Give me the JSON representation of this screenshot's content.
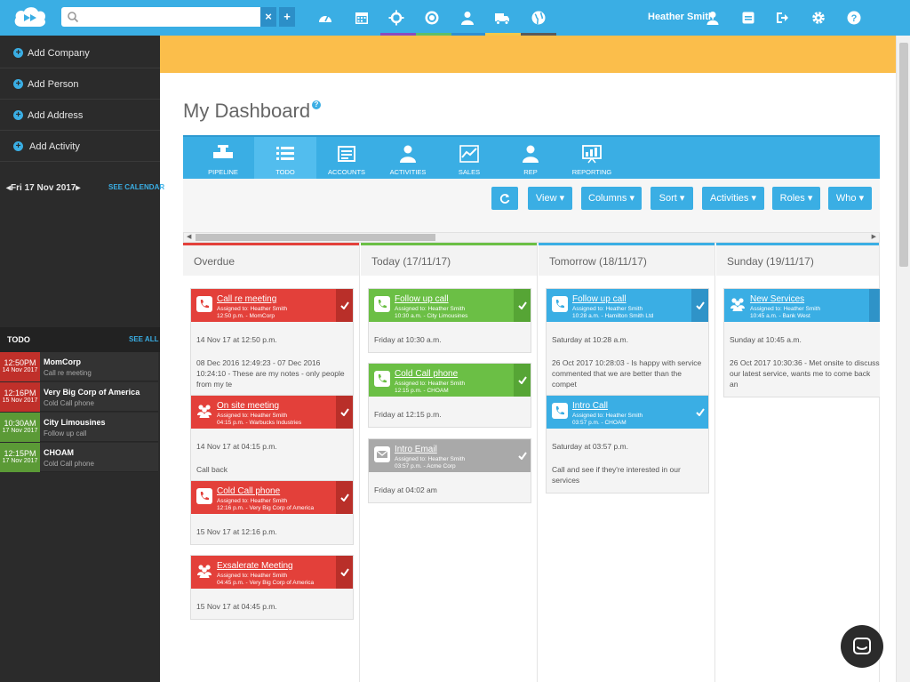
{
  "header": {
    "user_name": "Heather Smith",
    "search": {
      "value": "",
      "placeholder": ""
    },
    "clear_label": "×",
    "add_label": "+",
    "nav_icons": [
      "dashboard-icon",
      "calendar-icon",
      "pipeline-icon",
      "target-icon",
      "people-icon",
      "truck-icon",
      "globe-icon"
    ],
    "user_icons": [
      "user-icon",
      "inbox-icon",
      "logout-icon",
      "gear-icon",
      "help-icon"
    ]
  },
  "sidebar": {
    "actions": [
      "Add Company",
      "Add Person",
      "Add Address",
      "Add Activity"
    ],
    "calendar": {
      "date": "Fri 17 Nov 2017",
      "link": "SEE CALENDAR"
    },
    "todo": {
      "title": "TODO",
      "see_all": "SEE ALL",
      "items": [
        {
          "time": "12:50PM",
          "date": "14 Nov 2017",
          "title": "MomCorp",
          "subtitle": "Call re meeting",
          "color": "#c0302a"
        },
        {
          "time": "12:16PM",
          "date": "15 Nov 2017",
          "title": "Very Big Corp of America",
          "subtitle": "Cold Call phone",
          "color": "#c0302a"
        },
        {
          "time": "10:30AM",
          "date": "17 Nov 2017",
          "title": "City Limousines",
          "subtitle": "Follow up call",
          "color": "#5b9a36"
        },
        {
          "time": "12:15PM",
          "date": "17 Nov 2017",
          "title": "CHOAM",
          "subtitle": "Cold Call phone",
          "color": "#5b9a36"
        }
      ]
    }
  },
  "main": {
    "title": "My Dashboard",
    "help": "?",
    "tabs": [
      "PIPELINE",
      "TODO",
      "ACCOUNTS",
      "ACTIVITIES",
      "SALES",
      "REP",
      "REPORTING"
    ],
    "toolbar": {
      "refresh_icon": "refresh-icon",
      "buttons": [
        "View ▾",
        "Columns ▾",
        "Sort ▾",
        "Activities ▾",
        "Roles ▾",
        "Who ▾"
      ]
    },
    "columns": [
      {
        "title": "Overdue",
        "color": "#e3403a",
        "cards": [
          {
            "title": "Call re meeting",
            "assigned": "Assigned to: Heather Smith",
            "meta": "12:50 p.m. - MomCorp",
            "icon": "phone-icon",
            "when": "14 Nov 17 at 12:50 p.m.",
            "note": "08 Dec 2016 12:49:23 - 07 Dec 2016 10:24:10 - These are my notes - only people from my te"
          },
          {
            "title": "On site meeting",
            "assigned": "Assigned to: Heather Smith",
            "meta": "04:15 p.m. - Warbucks Industries",
            "icon": "meeting-icon",
            "when": "14 Nov 17 at 04:15 p.m.",
            "note": "Call back"
          },
          {
            "title": "Cold Call phone",
            "assigned": "Assigned to: Heather Smith",
            "meta": "12:16 p.m. - Very Big Corp of America",
            "icon": "phone-icon",
            "when": "15 Nov 17 at 12:16 p.m.",
            "note": ""
          },
          {
            "title": "Exsalerate Meeting",
            "assigned": "Assigned to: Heather Smith",
            "meta": "04:45 p.m. - Very Big Corp of America",
            "icon": "meeting-icon",
            "when": "15 Nov 17 at 04:45 p.m.",
            "note": ""
          }
        ]
      },
      {
        "title": "Today (17/11/17)",
        "color": "#6bbf45",
        "cards": [
          {
            "title": "Follow up call",
            "assigned": "Assigned to: Heather Smith",
            "meta": "10:30 a.m. - City Limousines",
            "icon": "phone-icon",
            "when": "Friday at 10:30 a.m.",
            "note": ""
          },
          {
            "title": "Cold Call phone",
            "assigned": "Assigned to: Heather Smith",
            "meta": "12:15 p.m. - CHOAM",
            "icon": "phone-icon",
            "when": "Friday at 12:15 p.m.",
            "note": ""
          },
          {
            "title": "Intro Email",
            "assigned": "Assigned to: Heather Smith",
            "meta": "03:57 p.m. - Acme Corp",
            "icon": "email-icon",
            "when": "Friday at 04:02 am",
            "note": ""
          }
        ]
      },
      {
        "title": "Tomorrow (18/11/17)",
        "color": "#3aaee4",
        "cards": [
          {
            "title": "Follow up call",
            "assigned": "Assigned to: Heather Smith",
            "meta": "10:28 a.m. - Hamilton Smith Ltd",
            "icon": "phone-icon",
            "when": "Saturday at 10:28 a.m.",
            "note": "26 Oct 2017 10:28:03 - Is happy with service commented that we are better than the compet"
          },
          {
            "title": "Intro Call",
            "assigned": "Assigned to: Heather Smith",
            "meta": "03:57 p.m. - CHOAM",
            "icon": "phone-icon",
            "when": "Saturday at 03:57 p.m.",
            "note": "Call and see if they're interested in our services"
          }
        ]
      },
      {
        "title": "Sunday (19/11/17)",
        "color": "#3aaee4",
        "cards": [
          {
            "title": "New Services",
            "assigned": "Assigned to: Heather Smith",
            "meta": "10:45 a.m. - Bank West",
            "icon": "meeting-icon",
            "when": "Sunday at 10:45 a.m.",
            "note": "26 Oct 2017 10:30:36 - Met onsite to discuss our latest service, wants me to come back an"
          }
        ]
      }
    ]
  }
}
